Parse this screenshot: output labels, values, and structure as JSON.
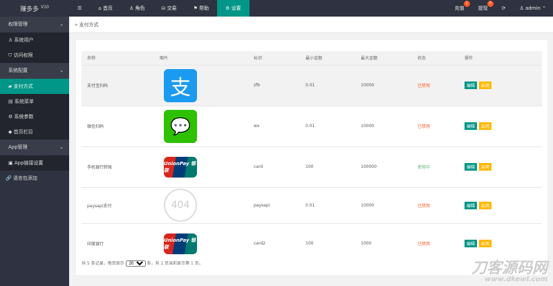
{
  "header": {
    "logo": "赚多多",
    "version": "V10",
    "nav": [
      "☰",
      "首页",
      "角色",
      "交易",
      "帮助",
      "设置"
    ],
    "recharge": "充值",
    "recharge_count": "1",
    "withdraw": "提现",
    "withdraw_count": "0",
    "refresh": "⟳",
    "user": "admin"
  },
  "sidebar": {
    "groups": [
      {
        "label": "权限管理",
        "items": [
          "系统用户",
          "访问权限"
        ]
      },
      {
        "label": "系统配置",
        "items": [
          "支付方式",
          "系统菜单",
          "系统参数",
          "首页栏目"
        ]
      },
      {
        "label": "App管理",
        "items": [
          "App链接设置"
        ]
      }
    ],
    "extra": "语言包添加"
  },
  "breadcrumb": "支付方式",
  "table": {
    "headers": [
      "名称",
      "图片",
      "标识",
      "最小金额",
      "最大金额",
      "状态",
      "操作"
    ],
    "rows": [
      {
        "name": "支付宝扫码",
        "img": "alipay",
        "code": "zfb",
        "min": "0.01",
        "max": "10000",
        "status": "已禁用"
      },
      {
        "name": "微信扫码",
        "img": "wechat",
        "code": "wx",
        "min": "0.01",
        "max": "10000",
        "status": "已禁用"
      },
      {
        "name": "手机银行转账",
        "img": "unionpay",
        "code": "card",
        "min": "100",
        "max": "100000",
        "status": "使用中"
      },
      {
        "name": "paysapi支付",
        "img": "404",
        "code": "paysapi",
        "min": "0.01",
        "max": "10000",
        "status": "已禁用"
      },
      {
        "name": "印度银行",
        "img": "unionpay",
        "code": "card2",
        "min": "100",
        "max": "1000",
        "status": "已禁用"
      }
    ],
    "edit": "编辑",
    "enable": "启用"
  },
  "footer": {
    "pre": "共 5 条记录，每页显示",
    "per_page": "20",
    "post": "条，共 1 页当前显示第 1 页。"
  },
  "watermark": {
    "cn": "刀客源码网",
    "url": "www.dkewl.com"
  },
  "unionpay_text": "UnionPay 银联",
  "img404": "404"
}
